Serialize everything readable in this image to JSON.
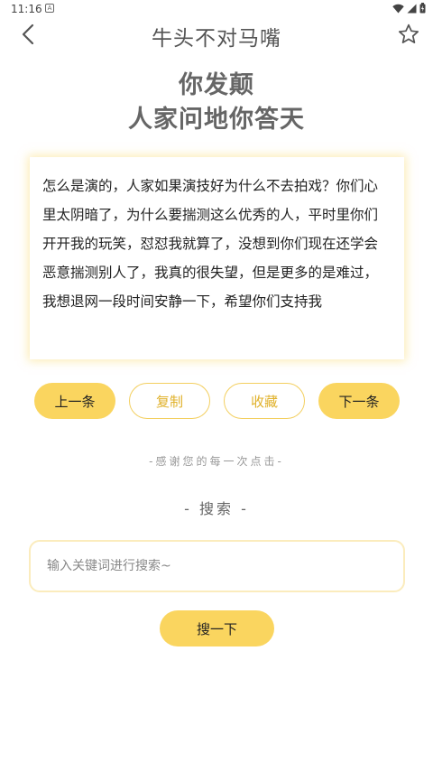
{
  "status_bar": {
    "time": "11:16",
    "notification_letter": "A"
  },
  "app_bar": {
    "title": "牛头不对马嘴",
    "icons": [
      "back-chevron-icon",
      "star-outline-icon"
    ]
  },
  "headline": {
    "line1": "你发颠",
    "line2": "人家问地你答天"
  },
  "quote": {
    "text": "怎么是演的，人家如果演技好为什么不去拍戏？你们心里太阴暗了，为什么要揣测这么优秀的人，平时里你们开开我的玩笑，怼怼我就算了，没想到你们现在还学会恶意揣测别人了，我真的很失望，但是更多的是难过，我想退网一段时间安静一下，希望你们支持我"
  },
  "actions": {
    "prev": "上一条",
    "copy": "复制",
    "favorite": "收藏",
    "next": "下一条"
  },
  "thanks_text": "-感谢您的每一次点击-",
  "search": {
    "heading": "- 搜索 -",
    "placeholder": "输入关键词进行搜索~",
    "value": "",
    "button": "搜一下"
  },
  "colors": {
    "accent": "#fad55f",
    "accent_text": "#e0b12a",
    "card_glow": "#fbecbd"
  }
}
